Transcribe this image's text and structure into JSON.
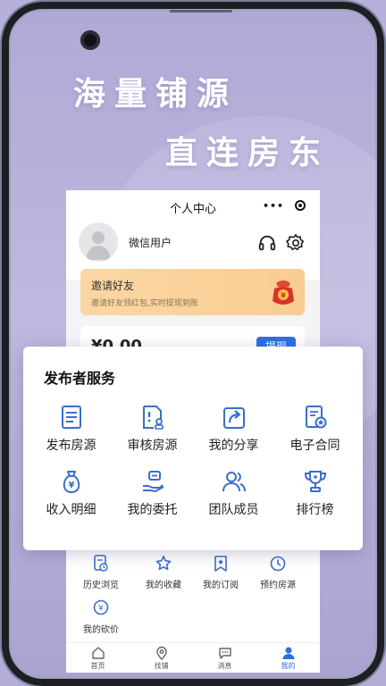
{
  "headline": {
    "line1": "海量铺源",
    "line2": "直连房东"
  },
  "screen": {
    "title": "个人中心",
    "capsule_dots": "•••",
    "username": "微信用户",
    "invite": {
      "title": "邀请好友",
      "subtitle": "邀请好友领红包,实时提现到账"
    },
    "wallet": {
      "amount": "¥0.00",
      "withdraw_label": "提现"
    },
    "more_services": [
      {
        "label": "历史浏览",
        "icon": "history-icon"
      },
      {
        "label": "我的收藏",
        "icon": "star-icon"
      },
      {
        "label": "我的订阅",
        "icon": "bookmark-icon"
      },
      {
        "label": "预约房源",
        "icon": "clock-icon"
      },
      {
        "label": "我的砍价",
        "icon": "bargain-icon"
      }
    ],
    "tabs": [
      {
        "label": "首页",
        "icon": "home-icon"
      },
      {
        "label": "找铺",
        "icon": "location-icon"
      },
      {
        "label": "消息",
        "icon": "message-icon"
      },
      {
        "label": "我的",
        "icon": "user-icon",
        "active": true
      }
    ]
  },
  "publisher": {
    "title": "发布者服务",
    "items": [
      {
        "label": "发布房源",
        "icon": "document-list-icon"
      },
      {
        "label": "审核房源",
        "icon": "review-icon"
      },
      {
        "label": "我的分享",
        "icon": "share-icon"
      },
      {
        "label": "电子合同",
        "icon": "contract-icon"
      },
      {
        "label": "收入明细",
        "icon": "money-bag-icon"
      },
      {
        "label": "我的委托",
        "icon": "hand-money-icon"
      },
      {
        "label": "团队成员",
        "icon": "team-icon"
      },
      {
        "label": "排行榜",
        "icon": "trophy-icon"
      }
    ]
  },
  "colors": {
    "background": "#b7afd9",
    "accent": "#2e6fe0",
    "icon_blue": "#3a6fc8",
    "invite_bg": "#fbd7a4"
  }
}
